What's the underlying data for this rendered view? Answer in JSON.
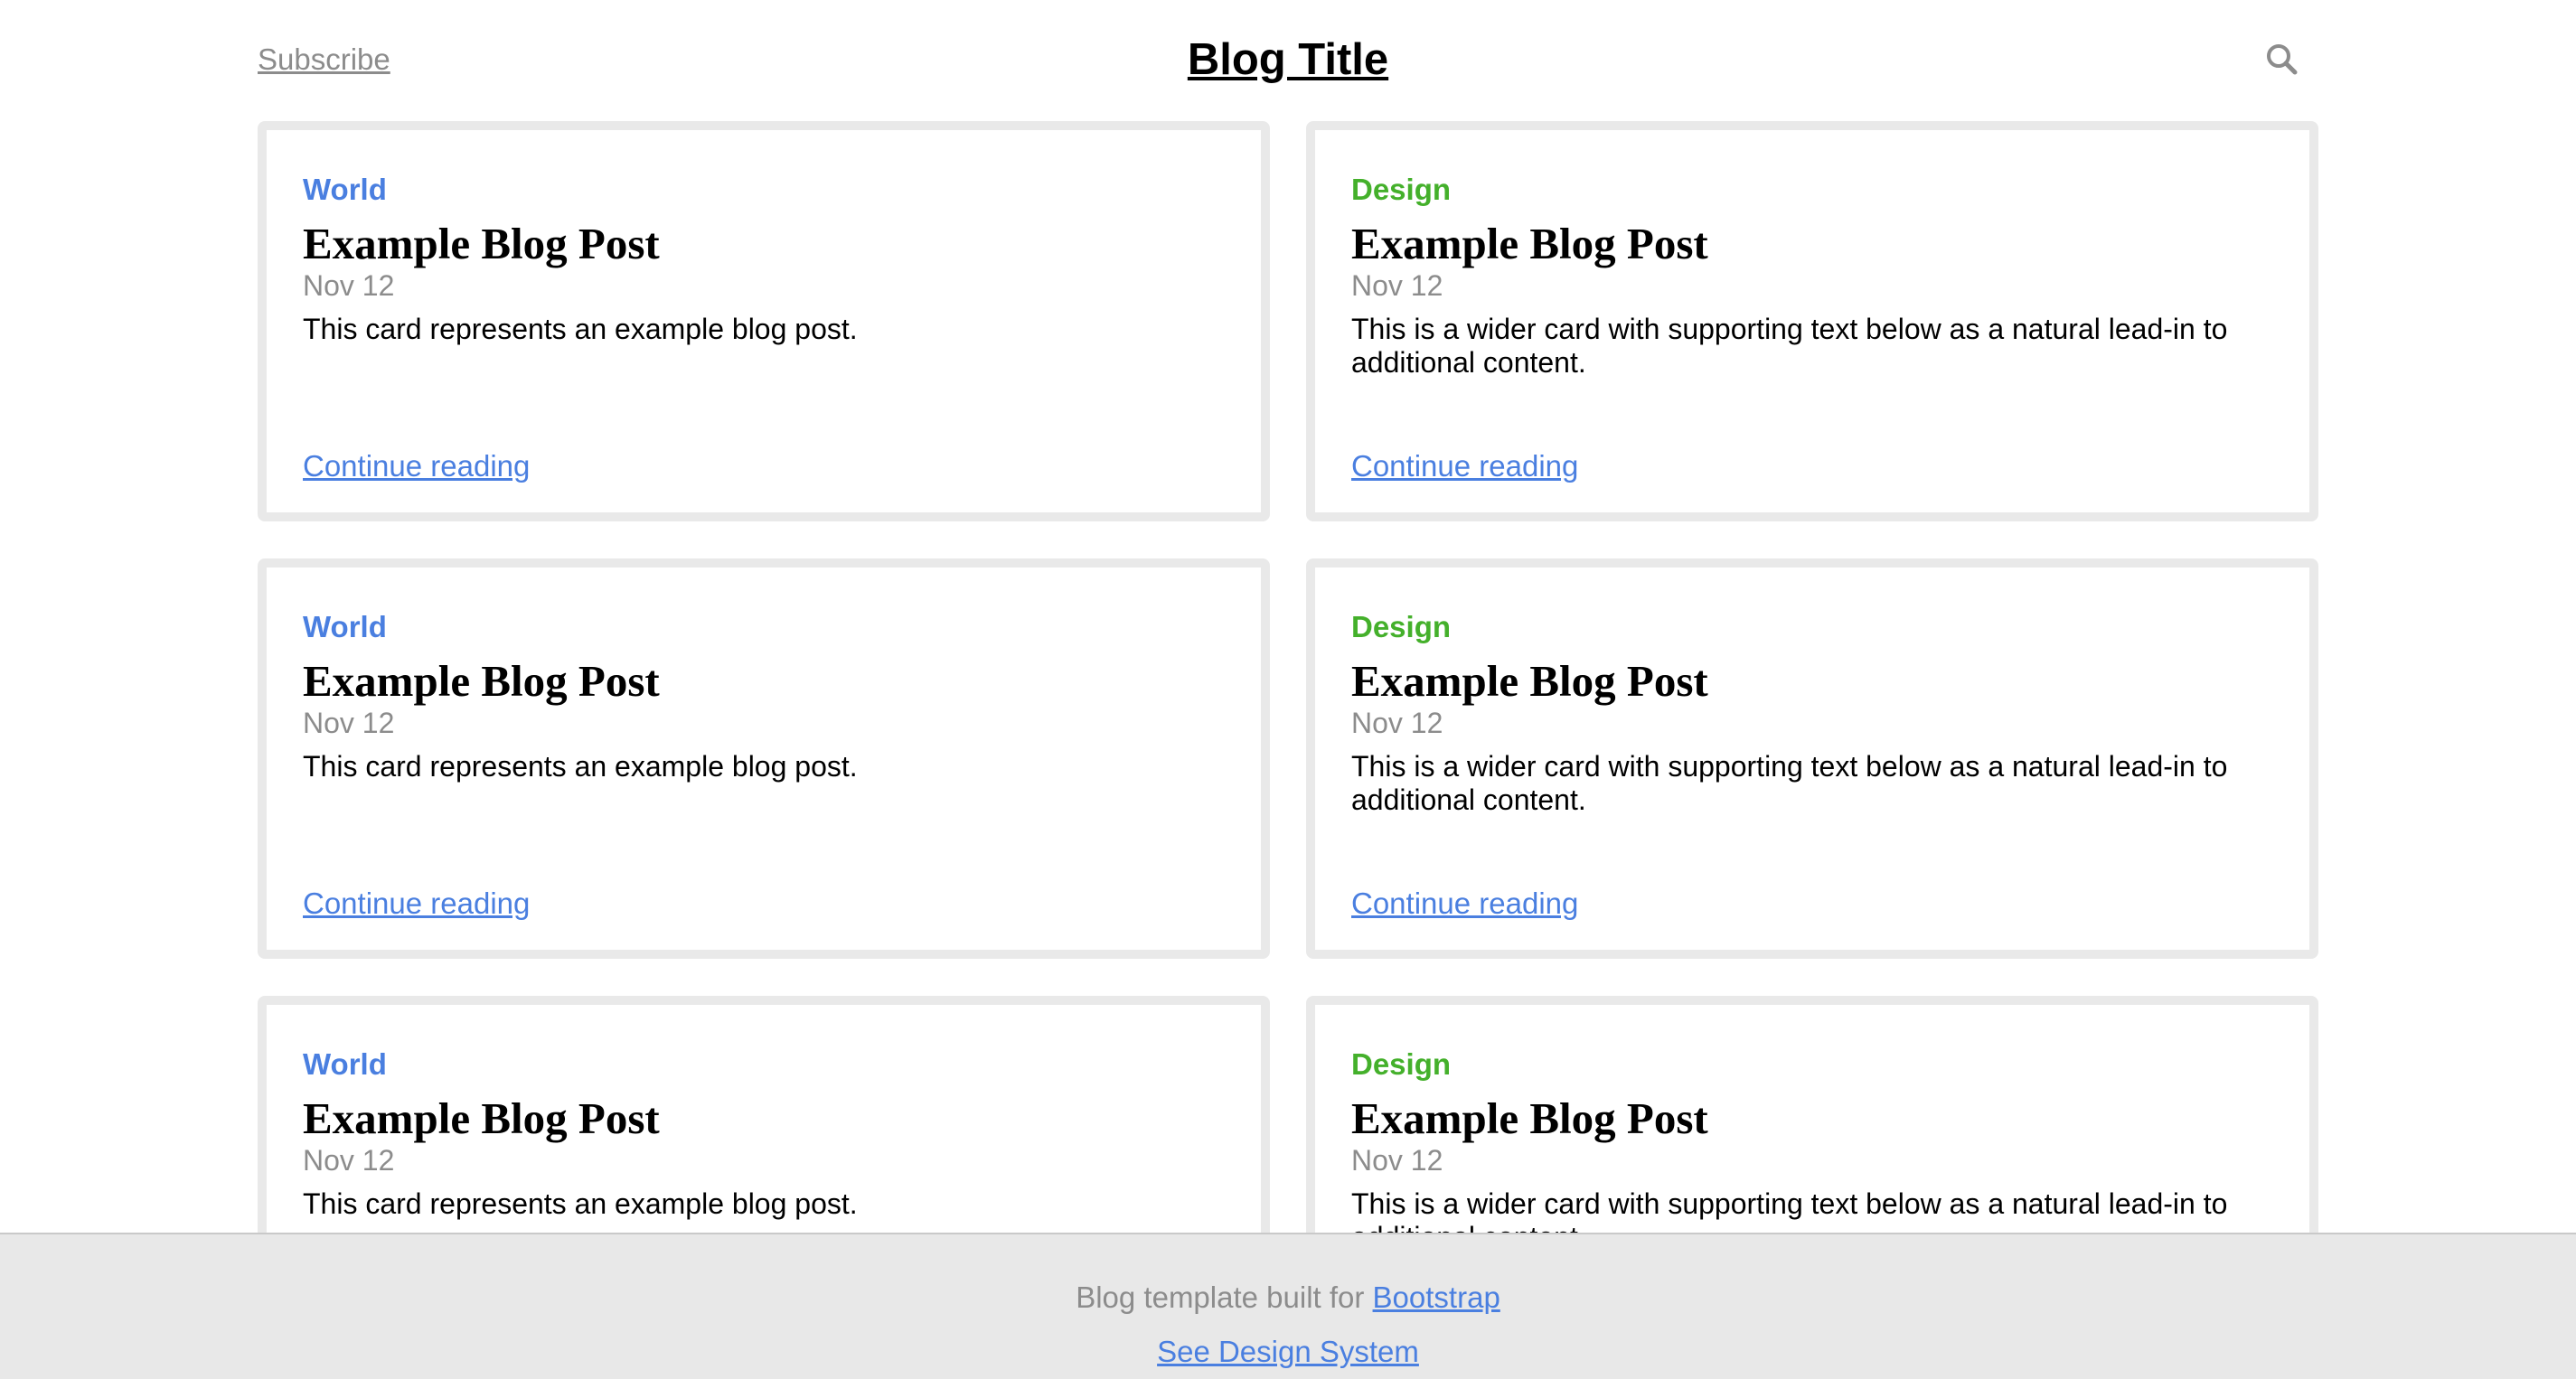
{
  "header": {
    "subscribe_label": "Subscribe",
    "title": "Blog Title",
    "search_icon": "search-icon"
  },
  "colors": {
    "world": "#4a7fe0",
    "design": "#44b02b",
    "link": "#4a7fe0",
    "muted": "#8c8c8c",
    "card_border": "#e9e9e9",
    "footer_bg": "#e8e8e8"
  },
  "cards": [
    {
      "category": "World",
      "title": "Example Blog Post",
      "date": "Nov 12",
      "text": "This card represents an example blog post.",
      "link": "Continue reading"
    },
    {
      "category": "Design",
      "title": "Example Blog Post",
      "date": "Nov 12",
      "text": "This is a wider card with supporting text below as a natural lead-in to additional content.",
      "link": "Continue reading"
    },
    {
      "category": "World",
      "title": "Example Blog Post",
      "date": "Nov 12",
      "text": "This card represents an example blog post.",
      "link": "Continue reading"
    },
    {
      "category": "Design",
      "title": "Example Blog Post",
      "date": "Nov 12",
      "text": "This is a wider card with supporting text below as a natural lead-in to additional content.",
      "link": "Continue reading"
    },
    {
      "category": "World",
      "title": "Example Blog Post",
      "date": "Nov 12",
      "text": "This card represents an example blog post."
    },
    {
      "category": "Design",
      "title": "Example Blog Post",
      "date": "Nov 12",
      "text": "This is a wider card with supporting text below as a natural lead-in to additional content."
    }
  ],
  "footer": {
    "text_prefix": "Blog template built for",
    "bootstrap_link": "Bootstrap",
    "design_system_link": "See Design System"
  }
}
